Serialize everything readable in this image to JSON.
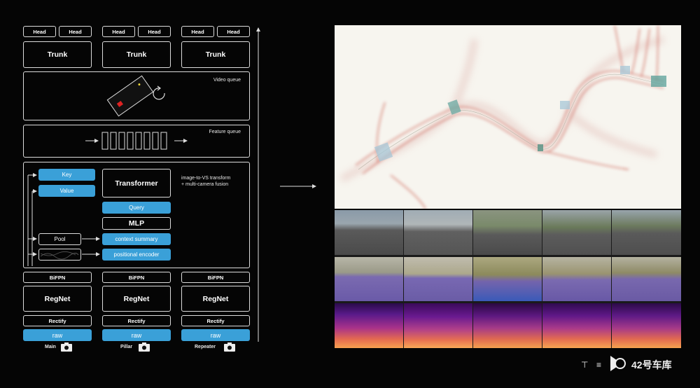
{
  "diagram": {
    "columns": [
      {
        "head1": "Head",
        "head2": "Head",
        "trunk": "Trunk",
        "bifpn": "BiFPN",
        "regnet": "RegNet",
        "rectify": "Rectify",
        "raw": "raw",
        "camera": "Main"
      },
      {
        "head1": "Head",
        "head2": "Head",
        "trunk": "Trunk",
        "bifpn": "BiFPN",
        "regnet": "RegNet",
        "rectify": "Rectify",
        "raw": "raw",
        "camera": "Pillar"
      },
      {
        "head1": "Head",
        "head2": "Head",
        "trunk": "Trunk",
        "bifpn": "BiFPN",
        "regnet": "RegNet",
        "rectify": "Rectify",
        "raw": "raw",
        "camera": "Repeater"
      }
    ],
    "video_queue": "Video queue",
    "feature_queue": "Feature queue",
    "key": "Key",
    "value": "Value",
    "transformer": "Transformer",
    "transform_note_1": "image-to-VS transform",
    "transform_note_2": "+ multi-camera fusion",
    "query": "Query",
    "mlp": "MLP",
    "pool": "Pool",
    "context_summary": "context summary",
    "positional_encoder": "positional encoder"
  },
  "footer": {
    "watermark": "42号车库"
  },
  "colors": {
    "accent_blue": "#3aa0d8",
    "background": "#050505",
    "map_background": "#f7f5ef",
    "road_red": "#c9544a"
  }
}
